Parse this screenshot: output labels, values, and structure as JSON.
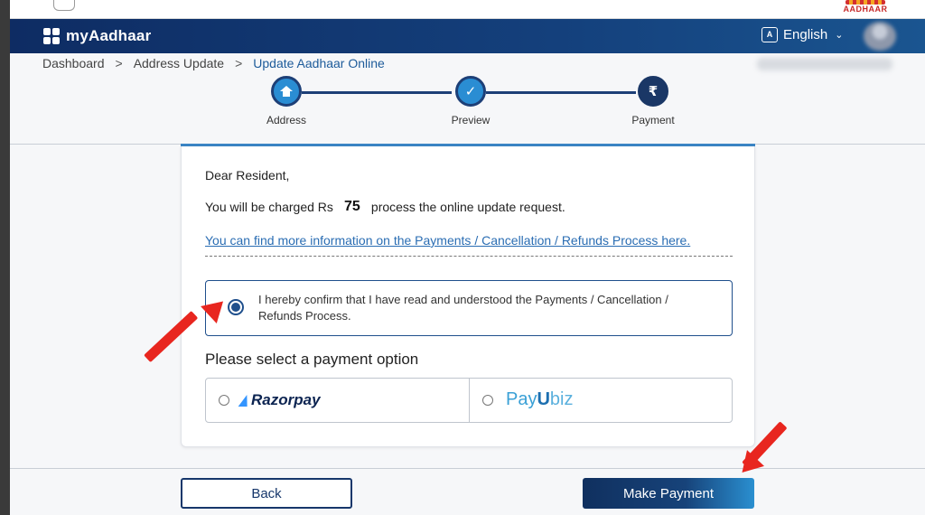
{
  "app": {
    "brand_name": "myAadhaar",
    "logo_text": "AADHAAR",
    "language_label": "English"
  },
  "breadcrumb": {
    "items": [
      "Dashboard",
      "Address Update",
      "Update Aadhaar Online"
    ],
    "separator": ">"
  },
  "stepper": {
    "steps": [
      {
        "label": "Address",
        "icon": "home-icon",
        "state": "done"
      },
      {
        "label": "Preview",
        "icon": "check-icon",
        "state": "done"
      },
      {
        "label": "Payment",
        "icon": "rupee-icon",
        "state": "current",
        "symbol": "₹"
      }
    ]
  },
  "notice": {
    "greeting": "Dear Resident,",
    "charge_prefix": "You will be charged Rs",
    "amount": "75",
    "charge_suffix": "process the online update request.",
    "info_link": "You can find more information on the Payments / Cancellation / Refunds Process here.",
    "confirm_text": "I hereby confirm that I have read and understood the Payments / Cancellation / Refunds Process.",
    "confirm_checked": true
  },
  "payment": {
    "heading": "Please select a payment option",
    "options": [
      {
        "name": "Razorpay",
        "selected": false
      },
      {
        "name_parts": [
          "Pay",
          "U",
          "biz"
        ],
        "selected": false
      }
    ]
  },
  "actions": {
    "back_label": "Back",
    "make_payment_label": "Make Payment"
  },
  "colors": {
    "navbar": "#14407c",
    "accent": "#2a8dd3",
    "annotation_arrow": "#e8261f",
    "link": "#2a6db3"
  }
}
